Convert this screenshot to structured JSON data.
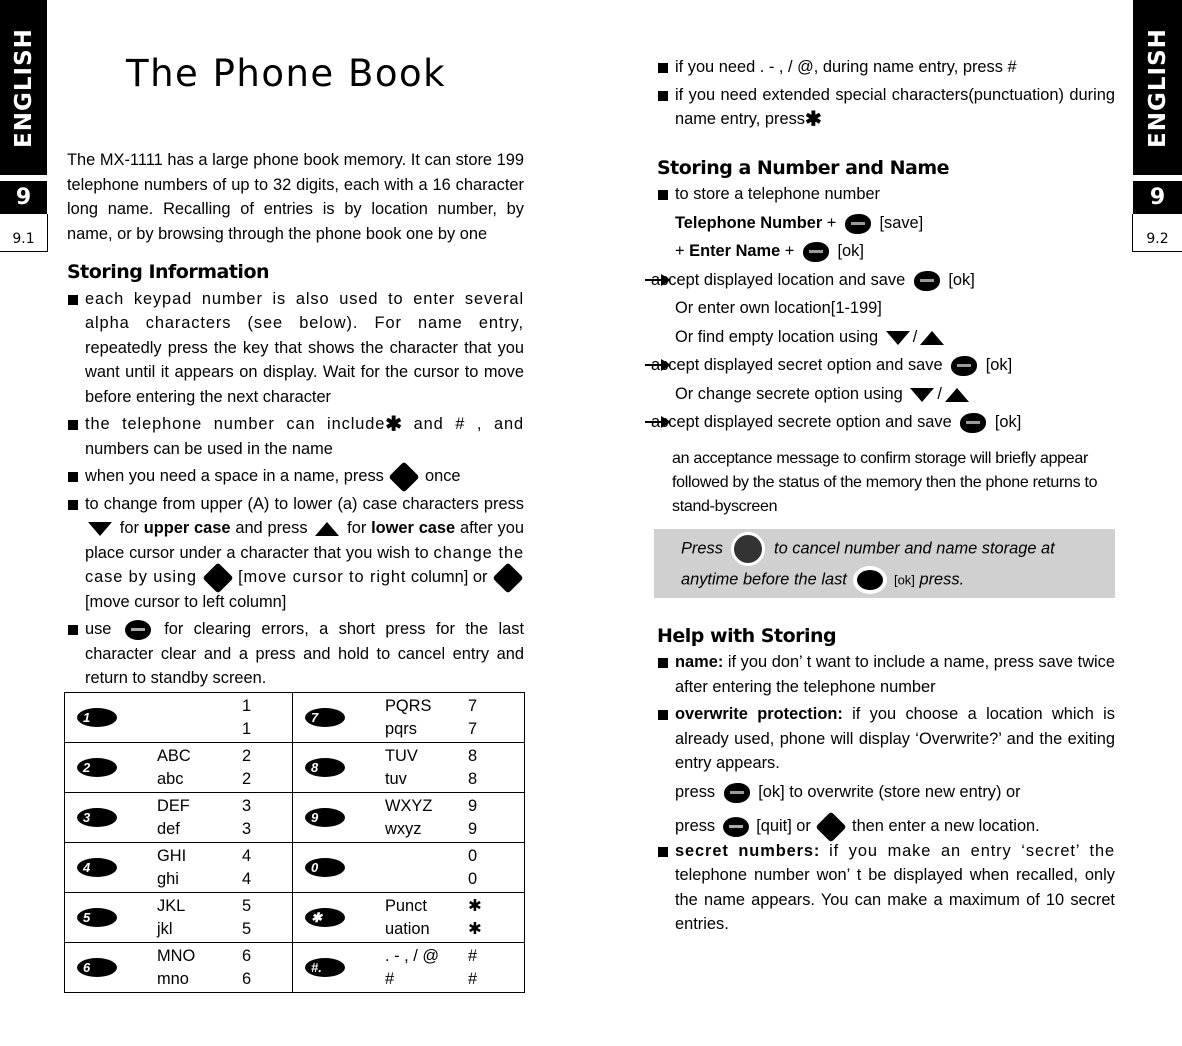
{
  "tabs": {
    "left": {
      "language": "ENGLISH",
      "chapter": "9",
      "page": "9.1"
    },
    "right": {
      "language": "ENGLISH",
      "chapter": "9",
      "page": "9.2"
    }
  },
  "title": "The Phone Book",
  "left": {
    "intro": "The MX-1111 has a large phone book memory. It can store 199 telephone numbers of up to 32 digits, each with a 16 character long name. Recalling of entries is by location number, by name, or by browsing through the phone book one by one",
    "heading": "Storing Information",
    "bullets": {
      "b1_a": "each keypad number is also used to enter several alpha characters (see below). For name entry,",
      "b1_b": "repeatedly press the key that shows the character that you want until it appears on display. Wait for the cursor to move before entering the next  character",
      "b2_a": "the telephone number can include",
      "b2_b": " and # , and",
      "b2_c": "numbers can be used in the name",
      "b3_a": "when you need a space in a name, press",
      "b3_b": "once",
      "b4_a": "to change from upper (A) to lower (a) case characters press",
      "b4_b": "for",
      "b4_upper": "upper case",
      "b4_c": "and press",
      "b4_d": "for",
      "b4_lower": "lower case",
      "b4_e": "after you place cursor under a character that you wish to",
      "b4_f": "change the case by using",
      "b4_g": "[move cursor to right",
      "b4_h": "column] or",
      "b4_i": "[move cursor to left column]",
      "b5_a": "use",
      "b5_b": "for clearing errors, a short press for the last character clear and a press and hold to cancel entry and return to standby screen."
    },
    "star_symbol": "✱",
    "keypad_table": [
      {
        "left": {
          "key": "1",
          "upper": "",
          "lower": "",
          "num_upper": "1",
          "num_lower": "1"
        },
        "right": {
          "key": "7",
          "upper": "PQRS",
          "lower": "pqrs",
          "num_upper": "7",
          "num_lower": "7"
        }
      },
      {
        "left": {
          "key": "2",
          "upper": "ABC",
          "lower": "abc",
          "num_upper": "2",
          "num_lower": "2"
        },
        "right": {
          "key": "8",
          "upper": "TUV",
          "lower": "tuv",
          "num_upper": "8",
          "num_lower": "8"
        }
      },
      {
        "left": {
          "key": "3",
          "upper": "DEF",
          "lower": "def",
          "num_upper": "3",
          "num_lower": "3"
        },
        "right": {
          "key": "9",
          "upper": "WXYZ",
          "lower": "wxyz",
          "num_upper": "9",
          "num_lower": "9"
        }
      },
      {
        "left": {
          "key": "4",
          "upper": "GHI",
          "lower": "ghi",
          "num_upper": "4",
          "num_lower": "4"
        },
        "right": {
          "key": "0",
          "upper": "",
          "lower": "",
          "num_upper": "0",
          "num_lower": "0"
        }
      },
      {
        "left": {
          "key": "5",
          "upper": "JKL",
          "lower": "jkl",
          "num_upper": "5",
          "num_lower": "5"
        },
        "right": {
          "key": "✱",
          "upper": "Punct",
          "lower": "uation",
          "num_upper": "✱",
          "num_lower": "✱"
        }
      },
      {
        "left": {
          "key": "6",
          "upper": "MNO",
          "lower": "mno",
          "num_upper": "6",
          "num_lower": "6"
        },
        "right": {
          "key": "#.",
          "upper": ". - , / @",
          "lower": "#",
          "num_upper": "#",
          "num_lower": "#"
        }
      }
    ]
  },
  "right": {
    "top_bullets": {
      "t1": "if you need . - , / @, during name entry, press #",
      "t2": "if you need extended special characters(punctuation) during name entry, press"
    },
    "heading_store": "Storing a Number and Name",
    "store": {
      "intro": "to store a telephone number",
      "tel_bold": "Telephone Number",
      "plus": "+",
      "save": "[save]",
      "plus2": "+",
      "name_bold": "Enter Name",
      "plus3": "+",
      "ok": "[ok]",
      "s1": "accept displayed location and save",
      "s1_ok": "[ok]",
      "s2": "Or enter own location[1-199]",
      "s3": "Or find empty location using",
      "slash": "/",
      "s4": "accept displayed secret option and save",
      "s4_ok": "[ok]",
      "s5": "Or change secrete option using",
      "s6": "accept displayed secrete option and save",
      "s6_ok": "[ok]"
    },
    "acceptance": "an acceptance message to confirm storage will briefly appear followed by the status of the memory then the phone returns to stand-byscreen",
    "note": {
      "a": "Press",
      "b": "to cancel number and name storage at anytime before the last",
      "ok": "[ok]",
      "c": "press."
    },
    "heading_help": "Help with Storing",
    "help": {
      "name_label": "name:",
      "name_text": "if you don’ t want to include a name, press save twice after entering the telephone number",
      "overwrite_label": "overwrite protection:",
      "overwrite_text": "if you choose a location which is already used, phone will display ‘Overwrite?’ and the exiting entry appears.",
      "press1": "press",
      "press1_b": "[ok] to overwrite (store new entry) or",
      "press2": "press",
      "press2_b": "[quit] or",
      "press2_c": "then enter a new location.",
      "secret_label": "secret numbers:",
      "secret_text_a": "if you make an entry  ‘secret’ the",
      "secret_text_b": "telephone number won’ t be displayed when recalled, only the name appears. You can make a maximum of 10 secret entries."
    }
  }
}
